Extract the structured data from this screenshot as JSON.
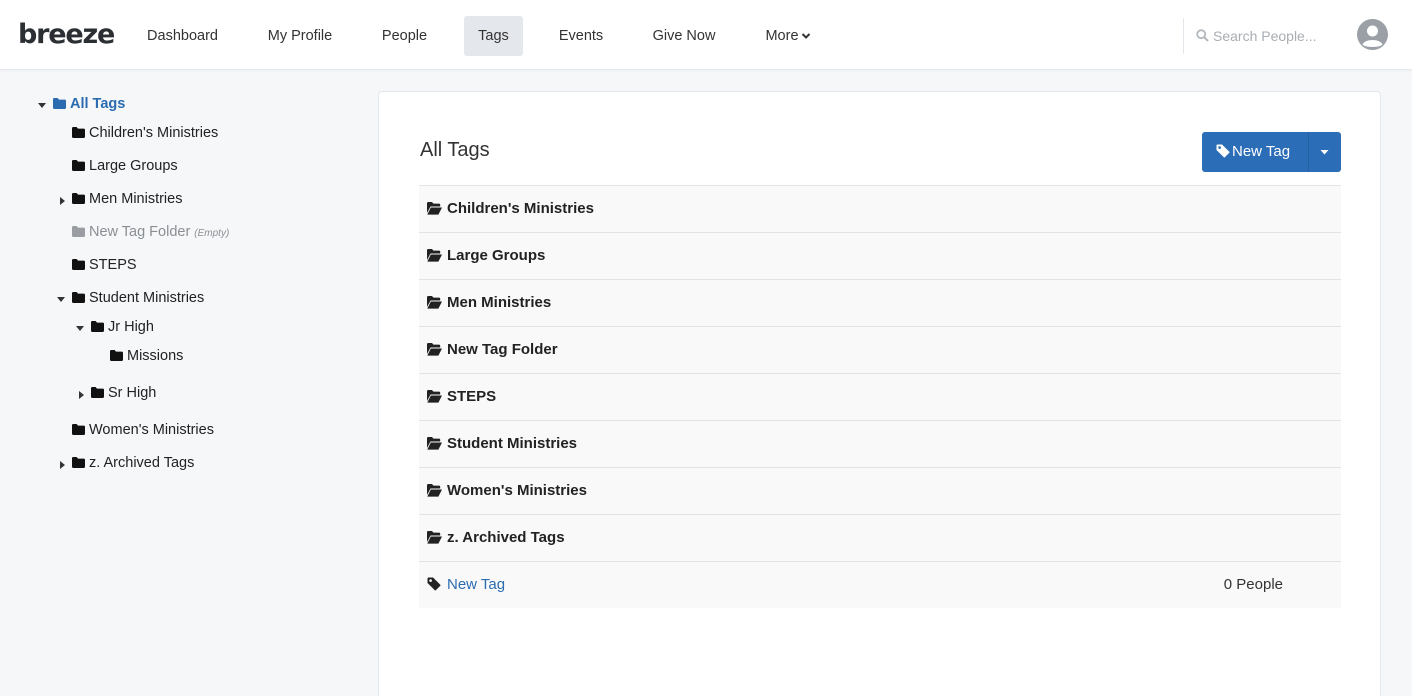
{
  "app": {
    "logo_text": "breeze"
  },
  "nav": {
    "items": [
      {
        "label": "Dashboard"
      },
      {
        "label": "My Profile"
      },
      {
        "label": "People"
      },
      {
        "label": "Tags",
        "active": true
      },
      {
        "label": "Events"
      },
      {
        "label": "Give Now"
      },
      {
        "label": "More"
      }
    ],
    "search_placeholder": "Search People..."
  },
  "sidebar": {
    "root": "All Tags",
    "items": [
      {
        "label": "Children's Ministries"
      },
      {
        "label": "Large Groups"
      },
      {
        "label": "Men Ministries",
        "toggle": "collapsed"
      },
      {
        "label": "New Tag Folder",
        "note": "(Empty)"
      },
      {
        "label": "STEPS"
      },
      {
        "label": "Student Ministries",
        "toggle": "expanded"
      },
      {
        "label": "Jr High",
        "toggle": "expanded"
      },
      {
        "label": "Missions"
      },
      {
        "label": "Sr High",
        "toggle": "collapsed"
      },
      {
        "label": "Women's Ministries"
      },
      {
        "label": "z. Archived Tags",
        "toggle": "collapsed"
      }
    ]
  },
  "main": {
    "title": "All Tags",
    "new_tag_button": "New Tag",
    "folders": [
      "Children's Ministries",
      "Large Groups",
      "Men Ministries",
      "New Tag Folder",
      "STEPS",
      "Student Ministries",
      "Women's Ministries",
      "z. Archived Tags"
    ],
    "tag": {
      "label": "New Tag",
      "count": "0 People"
    }
  },
  "colors": {
    "accent": "#2c6db7",
    "link": "#2b6cb0",
    "active_nav_bg": "#e4e7ec",
    "page_bg": "#f6f7f9"
  }
}
